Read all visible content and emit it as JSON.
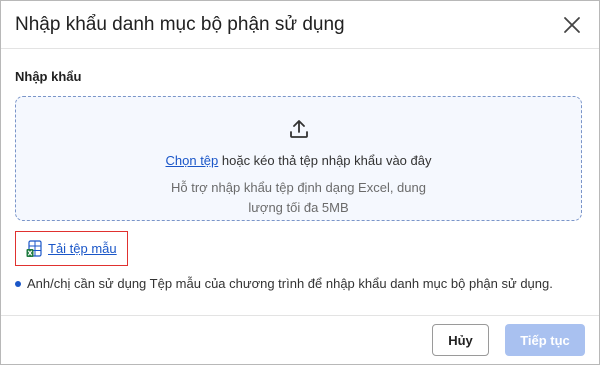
{
  "dialog": {
    "title": "Nhập khẩu danh mục bộ phận sử dụng",
    "close_icon": "close-icon"
  },
  "import": {
    "section_label": "Nhập khẩu",
    "upload_icon": "upload-icon",
    "choose_file_link": "Chọn tệp",
    "drop_text": " hoặc kéo thả tệp nhập khẩu vào đây",
    "support_text": "Hỗ trợ nhập khẩu tệp định dạng Excel, dung lượng tối đa 5MB",
    "template_icon": "excel-icon",
    "template_link": "Tải tệp mẫu",
    "note": "Anh/chị cần sử dụng Tệp mẫu của chương trình để nhập khẩu danh mục bộ phận sử dụng."
  },
  "footer": {
    "cancel_label": "Hủy",
    "continue_label": "Tiếp tục"
  },
  "colors": {
    "accent": "#1a56c8",
    "highlight_border": "#e0312f",
    "disabled_primary": "#a9c1f0",
    "dropzone_bg": "#f5f8fe"
  }
}
